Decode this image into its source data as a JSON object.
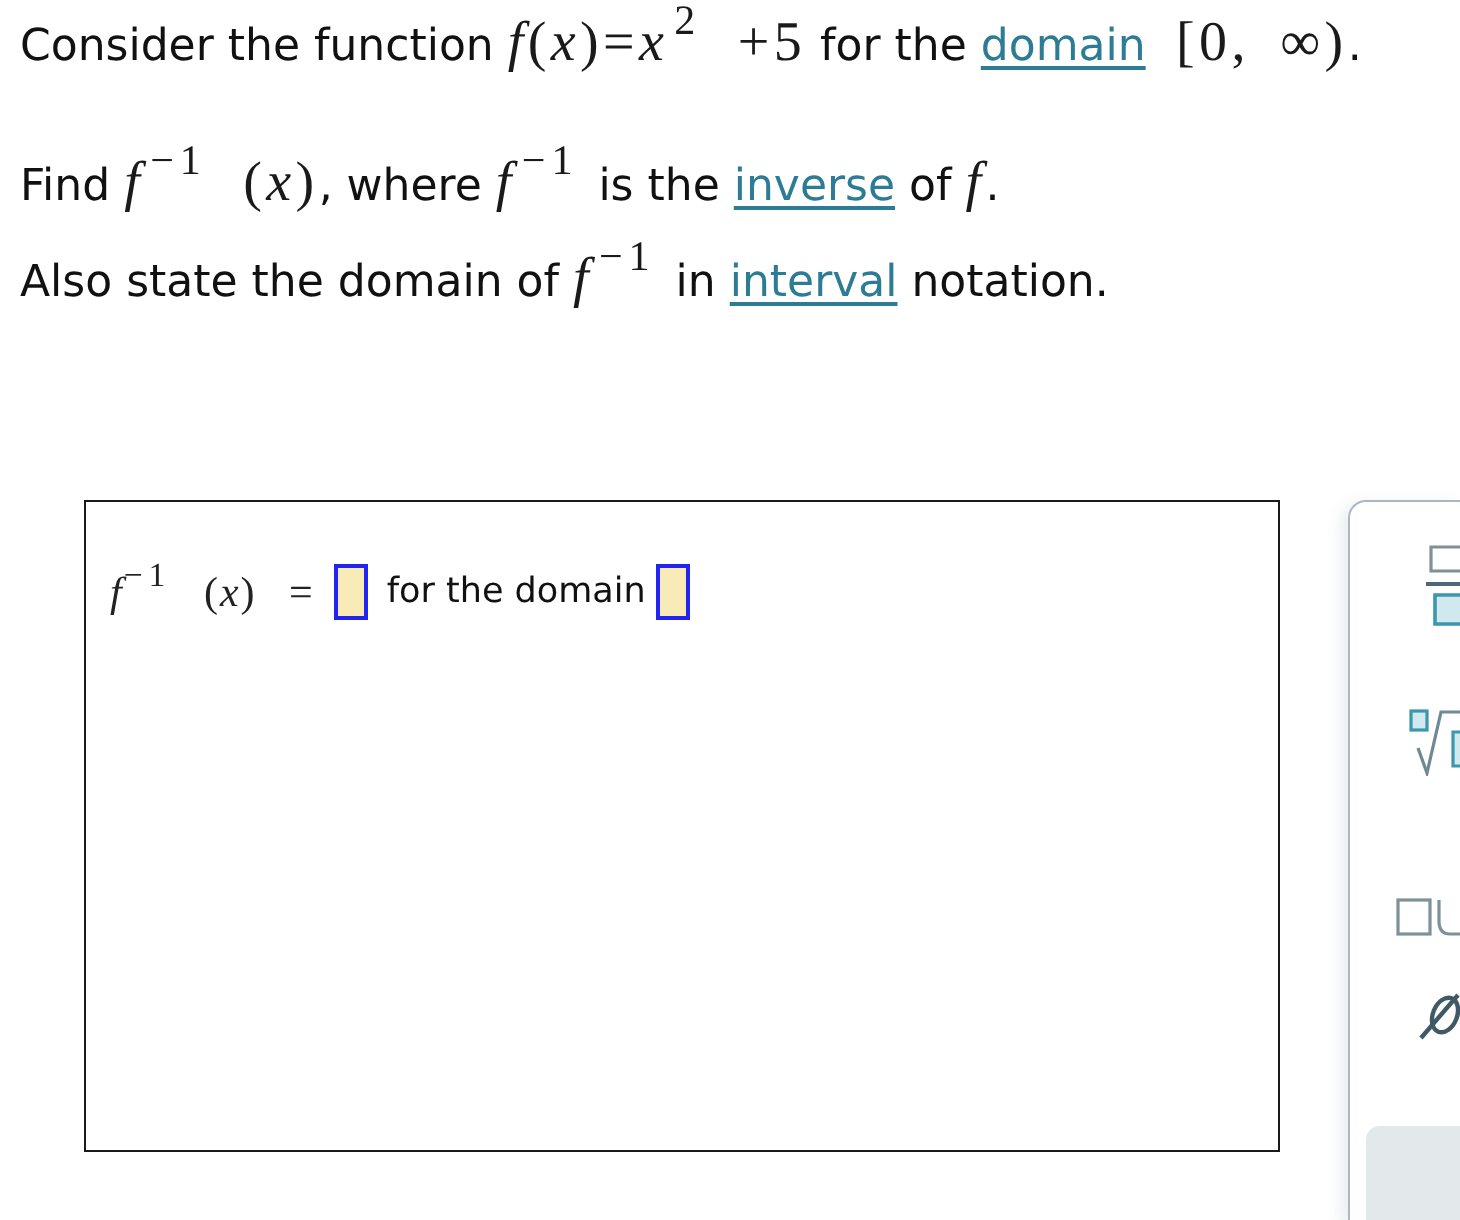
{
  "problem": {
    "paragraphs": [
      {
        "parts": [
          {
            "kind": "text",
            "text": "Consider the function "
          },
          {
            "kind": "math",
            "text": "*f*(*x*)=*x*$^{2}$ +5"
          },
          {
            "kind": "text",
            "text": " for the "
          },
          {
            "kind": "link",
            "text": "domain"
          },
          {
            "kind": "math",
            "text": " [0, ∞)"
          },
          {
            "kind": "text",
            "text": "."
          }
        ]
      },
      {
        "parts": [
          {
            "kind": "text",
            "text": "Find "
          },
          {
            "kind": "math",
            "text": "*f*$^{−1}$ (*x*)"
          },
          {
            "kind": "text",
            "text": ", where "
          },
          {
            "kind": "math",
            "text": "*f*$^{−1}$"
          },
          {
            "kind": "text",
            "text": " is the "
          },
          {
            "kind": "link",
            "text": "inverse"
          },
          {
            "kind": "text",
            "text": " of "
          },
          {
            "kind": "math",
            "text": "*f*"
          },
          {
            "kind": "text",
            "text": "."
          }
        ]
      },
      {
        "parts": [
          {
            "kind": "text",
            "text": "Also state the domain of "
          },
          {
            "kind": "math",
            "text": "*f*$^{−1}$"
          },
          {
            "kind": "text",
            "text": " in "
          },
          {
            "kind": "link",
            "text": "interval"
          },
          {
            "kind": "text",
            "text": " notation."
          }
        ]
      }
    ]
  },
  "answer": {
    "parts": [
      {
        "kind": "math",
        "text": "*f*$^{−1}$ (*x*) ="
      },
      {
        "kind": "blank"
      },
      {
        "kind": "text",
        "text": "for the domain"
      },
      {
        "kind": "blank"
      }
    ]
  },
  "palette": {
    "keys": [
      {
        "kind": "fraction"
      },
      {
        "kind": "root"
      },
      {
        "kind": "union"
      },
      {
        "kind": "empty_set"
      },
      {
        "kind": "key"
      }
    ]
  }
}
